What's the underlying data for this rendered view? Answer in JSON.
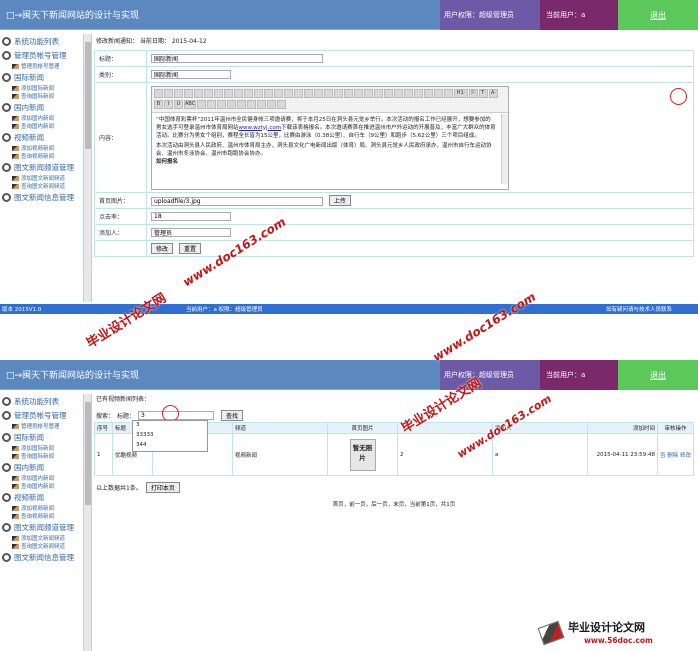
{
  "topbar": {
    "title": "□→闽天下新闻网站的设计与实现",
    "rights": "用户权限：超级管理员",
    "current_user": "当前用户：a",
    "logout": "退出"
  },
  "sidebar": {
    "title": "系统功能列表",
    "groups": [
      {
        "label": "管理员帐号管理",
        "items": [
          "管理员帐号管理"
        ]
      },
      {
        "label": "国际新闻",
        "items": [
          "添加国际新闻",
          "查询国际新闻"
        ]
      },
      {
        "label": "国内新闻",
        "items": [
          "添加国内新闻",
          "查询国内新闻"
        ]
      },
      {
        "label": "视频新闻",
        "items": [
          "添加视频新闻",
          "查询视频新闻"
        ]
      },
      {
        "label": "图文新闻频道管理",
        "items": [
          "添加图文新闻频道",
          "查询图文新闻频道"
        ]
      },
      {
        "label": "图文新闻信息管理",
        "items": []
      }
    ]
  },
  "edit": {
    "header": "修改新闻通知： 当前日期： 2015-04-12",
    "labels": {
      "title": "标题：",
      "category": "类别：",
      "content": "内容：",
      "image": "首页图片：",
      "clicks": "点击率：",
      "author": "添加人："
    },
    "values": {
      "title": "国际新闻",
      "category": "国际新闻",
      "image": "uploadfile/3.jpg",
      "clicks": "18",
      "author": "管理员"
    },
    "upload": "上传",
    "submit": "修改",
    "reset": "重置",
    "editor_tool_labels": [
      "H1·",
      "ℱ·",
      "T·",
      "A·",
      "B",
      "I",
      "U",
      "ABC"
    ],
    "editor_text": [
      "“中国体育彩票杯”2011年温州市全民健身帐三项邀请赛，将于本月25日在洞头县元觉乡举行。本次活动的报名工作已经展开，想要参加的男女选手可登录温州市体育局网站",
      "www.wztyj.com",
      "下载该表格报名。本次邀请赛首在推进温州市户外运动的开展普及，丰富广大群众的体育活动。比赛分为男女个组别，赛程全长皆为15公里，比赛由游泳（0.38公里）、自行车（9公里）和跑步（5.62公里）三个项目组成。",
      "本次活动由洞头县人民政府、温州市体育局主办，洞头县文化广电新闻出版（体育）局、洞头县元觉乡人民政府承办，温州市自行车运动协会、温州市冬泳协会、温州市跑跑协会协办。",
      "如何报名"
    ]
  },
  "bottombar": {
    "left": "版本 2015V1.0",
    "mid": "当前用户：a 权限：超级管理员",
    "right": "如有疑问请与技术人员联系"
  },
  "list": {
    "header": "已有视频新闻列表：",
    "search_label": "搜索：",
    "search_field_label": "标题：",
    "search_value": "3",
    "search_button": "查找",
    "suggestions": [
      "3",
      "33333",
      "344"
    ],
    "columns": [
      "序号",
      "标题",
      "频道",
      "首页图片",
      "",
      "添加人",
      "添加时间",
      "审核操作"
    ],
    "rows": [
      {
        "no": "1",
        "title": "优酷视频",
        "channel": "视频新闻",
        "image_text": "暂无照片",
        "count": "2",
        "author": "a",
        "time": "2015-04-11 23:59:48",
        "ops": "否 删除 修改"
      }
    ],
    "summary": "以上数据共1条。",
    "print": "打印本页",
    "pager": "首页，前一页，后一页，末页，当前第1页，共1页"
  },
  "watermarks": {
    "wm1": "毕业设计论文网",
    "wm2": "www.doc163.com",
    "logo_text": "毕业设计论文网",
    "logo_url": "www.56doc.com"
  }
}
